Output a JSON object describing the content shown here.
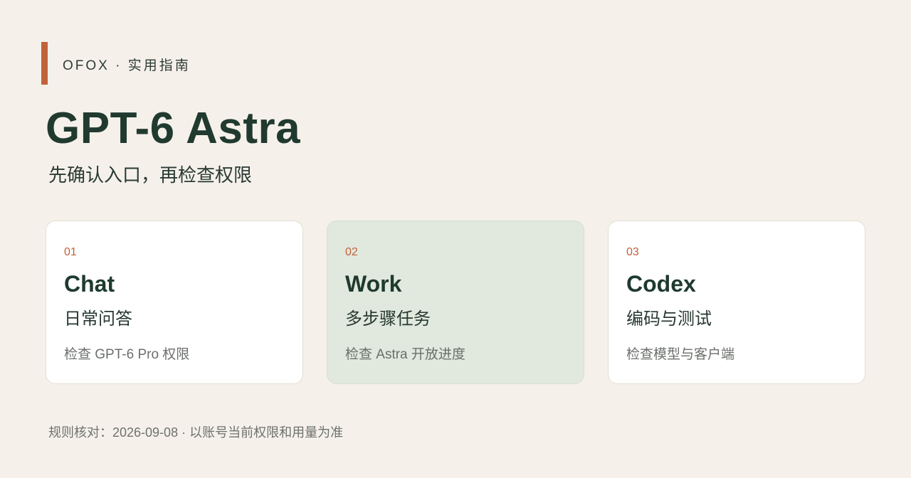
{
  "header": {
    "kicker": "OFOX · 实用指南",
    "title": "GPT-6 Astra",
    "subtitle": "先确认入口，再检查权限"
  },
  "cards": [
    {
      "num": "01",
      "name": "Chat",
      "desc": "日常问答",
      "note": "检查 GPT-6 Pro 权限",
      "highlighted": false
    },
    {
      "num": "02",
      "name": "Work",
      "desc": "多步骤任务",
      "note": "检查 Astra 开放进度",
      "highlighted": true
    },
    {
      "num": "03",
      "name": "Codex",
      "desc": "编码与测试",
      "note": "检查模型与客户端",
      "highlighted": false
    }
  ],
  "footer": {
    "text": "规则核对：2026-09-08 · 以账号当前权限和用量为准"
  },
  "colors": {
    "background": "#f5f1ea",
    "accent": "#c0623a",
    "text_primary": "#1f3a2f",
    "card_highlight": "#e1e8dd",
    "card_default": "#ffffff"
  }
}
